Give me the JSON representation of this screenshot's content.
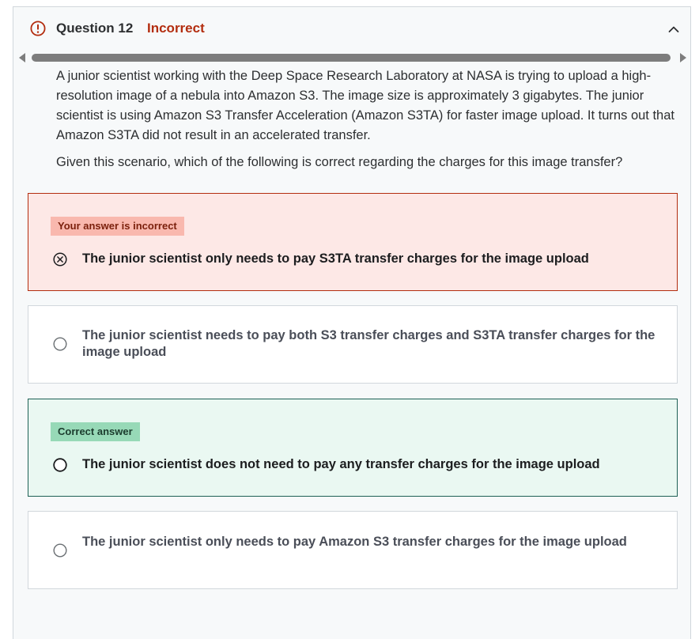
{
  "header": {
    "question_label": "Question 12",
    "status": "Incorrect",
    "status_color": "#b32d0f",
    "alert_icon": "alert-circle-icon",
    "collapse_icon": "chevron-up-icon"
  },
  "prompt": {
    "paragraph1": "A junior scientist working with the Deep Space Research Laboratory at NASA is trying to upload a high-resolution image of a nebula into Amazon S3. The image size is approximately 3 gigabytes. The junior scientist is using Amazon S3 Transfer Acceleration (Amazon S3TA) for faster image upload. It turns out that Amazon S3TA did not result in an accelerated transfer.",
    "paragraph2": "Given this scenario, which of the following is correct regarding the charges for this image transfer?"
  },
  "options": [
    {
      "badge": "Your answer is incorrect",
      "text": "The junior scientist only needs to pay S3TA transfer charges for the image upload",
      "state": "selected-incorrect"
    },
    {
      "text": "The junior scientist needs to pay both S3 transfer charges and S3TA transfer charges for the image upload",
      "state": "unselected"
    },
    {
      "badge": "Correct answer",
      "text": "The junior scientist does not need to pay any transfer charges for the image upload",
      "state": "correct"
    },
    {
      "text": "The junior scientist only needs to pay Amazon S3 transfer charges for the image upload",
      "state": "unselected"
    }
  ],
  "colors": {
    "incorrect_bg": "#fde8e6",
    "incorrect_border": "#b32d0f",
    "correct_bg": "#eaf8f2",
    "correct_border": "#1e6055"
  }
}
